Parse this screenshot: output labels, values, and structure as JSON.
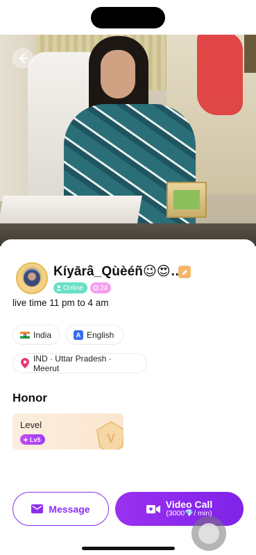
{
  "profile": {
    "name": "Kíyārâ_Qùèéñ😉😍…",
    "online_label": "Online",
    "age": "24",
    "live_time": "live time 11 pm to 4 am"
  },
  "chips": {
    "country": "India",
    "language_icon_letter": "A",
    "language": "English",
    "location": "IND · Uttar Pradesh · Meerut"
  },
  "honor": {
    "title": "Honor",
    "level_label": "Level",
    "level_badge": "Lv5",
    "shield_letter": "V"
  },
  "actions": {
    "message_label": "Message",
    "video_call_label": "Video Call",
    "video_call_price": "(3000💎/ min)"
  },
  "colors": {
    "accent": "#8b2ef0",
    "online": "#67e0c4",
    "age_badge": "#f3a0ee",
    "level_card": "#fbeede"
  },
  "icons": [
    "back-arrow-icon",
    "edit-icon",
    "user-icon",
    "age-icon",
    "india-flag-icon",
    "language-icon",
    "location-pin-icon",
    "level-shield-icon",
    "message-icon",
    "video-call-icon",
    "diamond-icon"
  ]
}
